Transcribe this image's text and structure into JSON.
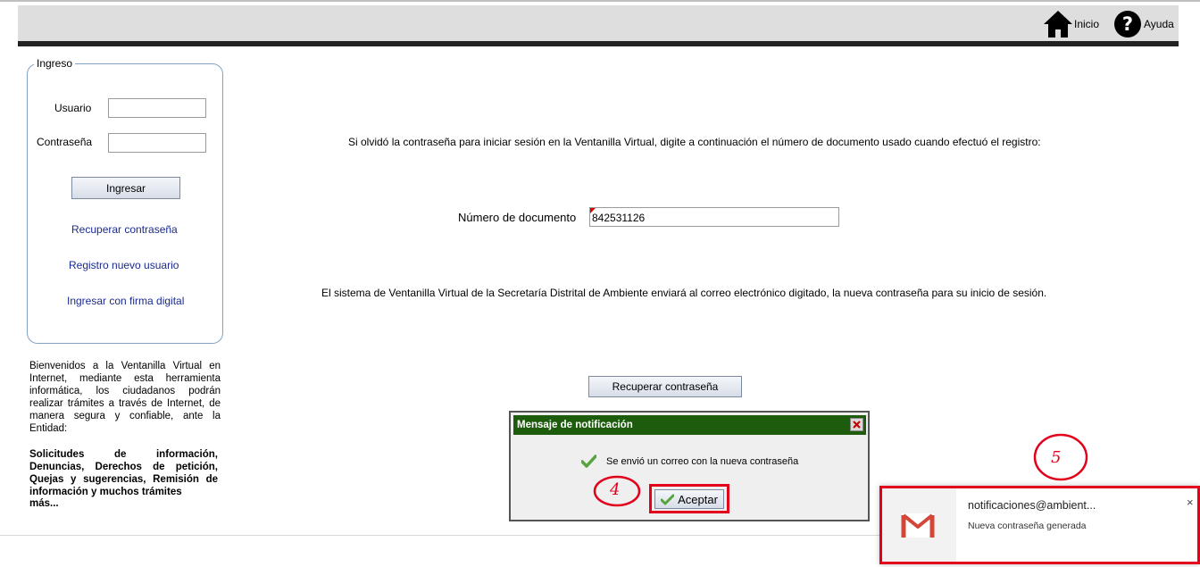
{
  "header": {
    "home_label": "Inicio",
    "help_label": "Ayuda"
  },
  "login": {
    "legend": "Ingreso",
    "user_label": "Usuario",
    "user_value": "",
    "password_label": "Contraseña",
    "password_value": "",
    "submit_label": "Ingresar",
    "links": {
      "recover": "Recuperar contraseña",
      "register": "Registro nuevo usuario",
      "digital_signature": "Ingresar con firma digital"
    }
  },
  "welcome": {
    "text": "Bienvenidos a la Ventanilla Virtual en Internet, mediante esta herramienta informática, los ciudadanos podrán realizar trámites a través de Internet, de manera segura y confiable, ante la Entidad:",
    "bold_text": "Solicitudes de información, Denuncias, Derechos de petición, Quejas y sugerencias, Remisión de información y muchos trámites",
    "bold_last": "más..."
  },
  "main": {
    "instruction": "Si olvidó la contraseña para iniciar sesión en la Ventanilla Virtual, digite a continuación el número de documento usado cuando efectuó el registro:",
    "document_label": "Número de documento",
    "document_value": "842531126",
    "info": "El sistema de Ventanilla Virtual de la Secretaría Distrital de Ambiente enviará al correo electrónico digitado, la nueva contraseña para su inicio de sesión.",
    "recover_button": "Recuperar contraseña"
  },
  "dialog": {
    "title": "Mensaje de notificación",
    "message": "Se envió un correo con la nueva contraseña",
    "accept_label": "Aceptar"
  },
  "annotations": {
    "step4": "4",
    "step5": "5"
  },
  "toast": {
    "sender": "notificaciones@ambient...",
    "subject": "Nueva contraseña generada",
    "close_symbol": "×"
  },
  "icons": {
    "home": "home-icon",
    "help": "help-icon",
    "gmail": "gmail-icon",
    "check": "check-icon",
    "close": "close-icon"
  },
  "colors": {
    "dialog_title_bg": "#1e5c0d",
    "link": "#1a2a8f",
    "annotation_red": "#e2001a",
    "header_bg": "#dedede"
  }
}
